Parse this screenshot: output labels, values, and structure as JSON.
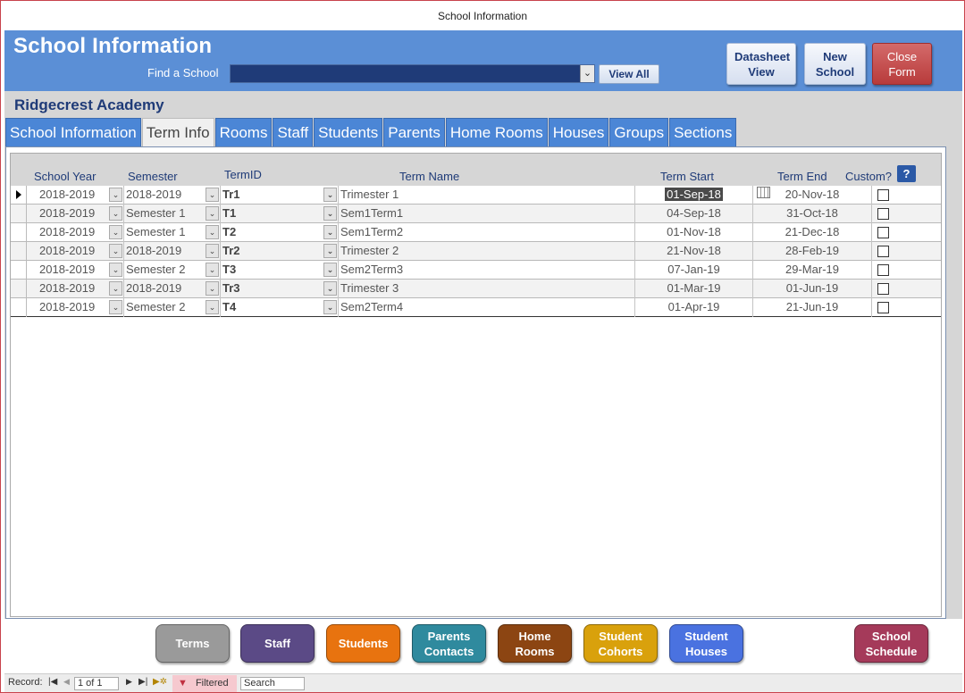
{
  "window_title": "School Information",
  "header": {
    "title": "School Information",
    "find_label": "Find a School",
    "find_value": "",
    "view_all_label": "View All",
    "datasheet_view_label": "Datasheet View",
    "new_school_label": "New School",
    "close_form_label": "Close Form"
  },
  "school_name": "Ridgecrest Academy",
  "tabs": [
    {
      "label": "School Information",
      "active": false
    },
    {
      "label": "Term Info",
      "active": true
    },
    {
      "label": "Rooms",
      "active": false
    },
    {
      "label": "Staff",
      "active": false
    },
    {
      "label": "Students",
      "active": false
    },
    {
      "label": "Parents",
      "active": false
    },
    {
      "label": "Home Rooms",
      "active": false
    },
    {
      "label": "Houses",
      "active": false
    },
    {
      "label": "Groups",
      "active": false
    },
    {
      "label": "Sections",
      "active": false
    }
  ],
  "grid": {
    "columns": {
      "school_year": "School Year",
      "semester": "Semester",
      "term_id": "TermID",
      "term_name": "Term Name",
      "term_start": "Term Start",
      "term_end": "Term End",
      "custom": "Custom?"
    },
    "help_label": "?",
    "rows": [
      {
        "school_year": "2018-2019",
        "semester": "2018-2019",
        "term_id": "Tr1",
        "term_name": "Trimester 1",
        "term_start": "01-Sep-18",
        "term_end": "20-Nov-18",
        "custom": false
      },
      {
        "school_year": "2018-2019",
        "semester": "Semester 1",
        "term_id": "T1",
        "term_name": "Sem1Term1",
        "term_start": "04-Sep-18",
        "term_end": "31-Oct-18",
        "custom": false
      },
      {
        "school_year": "2018-2019",
        "semester": "Semester 1",
        "term_id": "T2",
        "term_name": "Sem1Term2",
        "term_start": "01-Nov-18",
        "term_end": "21-Dec-18",
        "custom": false
      },
      {
        "school_year": "2018-2019",
        "semester": "2018-2019",
        "term_id": "Tr2",
        "term_name": "Trimester 2",
        "term_start": "21-Nov-18",
        "term_end": "28-Feb-19",
        "custom": false
      },
      {
        "school_year": "2018-2019",
        "semester": "Semester 2",
        "term_id": "T3",
        "term_name": "Sem2Term3",
        "term_start": "07-Jan-19",
        "term_end": "29-Mar-19",
        "custom": false
      },
      {
        "school_year": "2018-2019",
        "semester": "2018-2019",
        "term_id": "Tr3",
        "term_name": "Trimester 3",
        "term_start": "01-Mar-19",
        "term_end": "01-Jun-19",
        "custom": false
      },
      {
        "school_year": "2018-2019",
        "semester": "Semester 2",
        "term_id": "T4",
        "term_name": "Sem2Term4",
        "term_start": "01-Apr-19",
        "term_end": "21-Jun-19",
        "custom": false
      }
    ]
  },
  "nav_buttons": [
    {
      "label": "Terms",
      "color": "#9a9a9a"
    },
    {
      "label": "Staff",
      "color": "#5b4a86"
    },
    {
      "label": "Students",
      "color": "#e8730f"
    },
    {
      "label": "Parents Contacts",
      "color": "#2f8a9e"
    },
    {
      "label": "Home Rooms",
      "color": "#8c4512"
    },
    {
      "label": "Student Cohorts",
      "color": "#d9a10c"
    },
    {
      "label": "Student Houses",
      "color": "#4a72e0"
    },
    {
      "label": "School Schedule",
      "color": "#a53a5a"
    }
  ],
  "status": {
    "record_label": "Record:",
    "record_value": "1 of 1",
    "filtered_label": "Filtered",
    "search_value": "Search"
  }
}
